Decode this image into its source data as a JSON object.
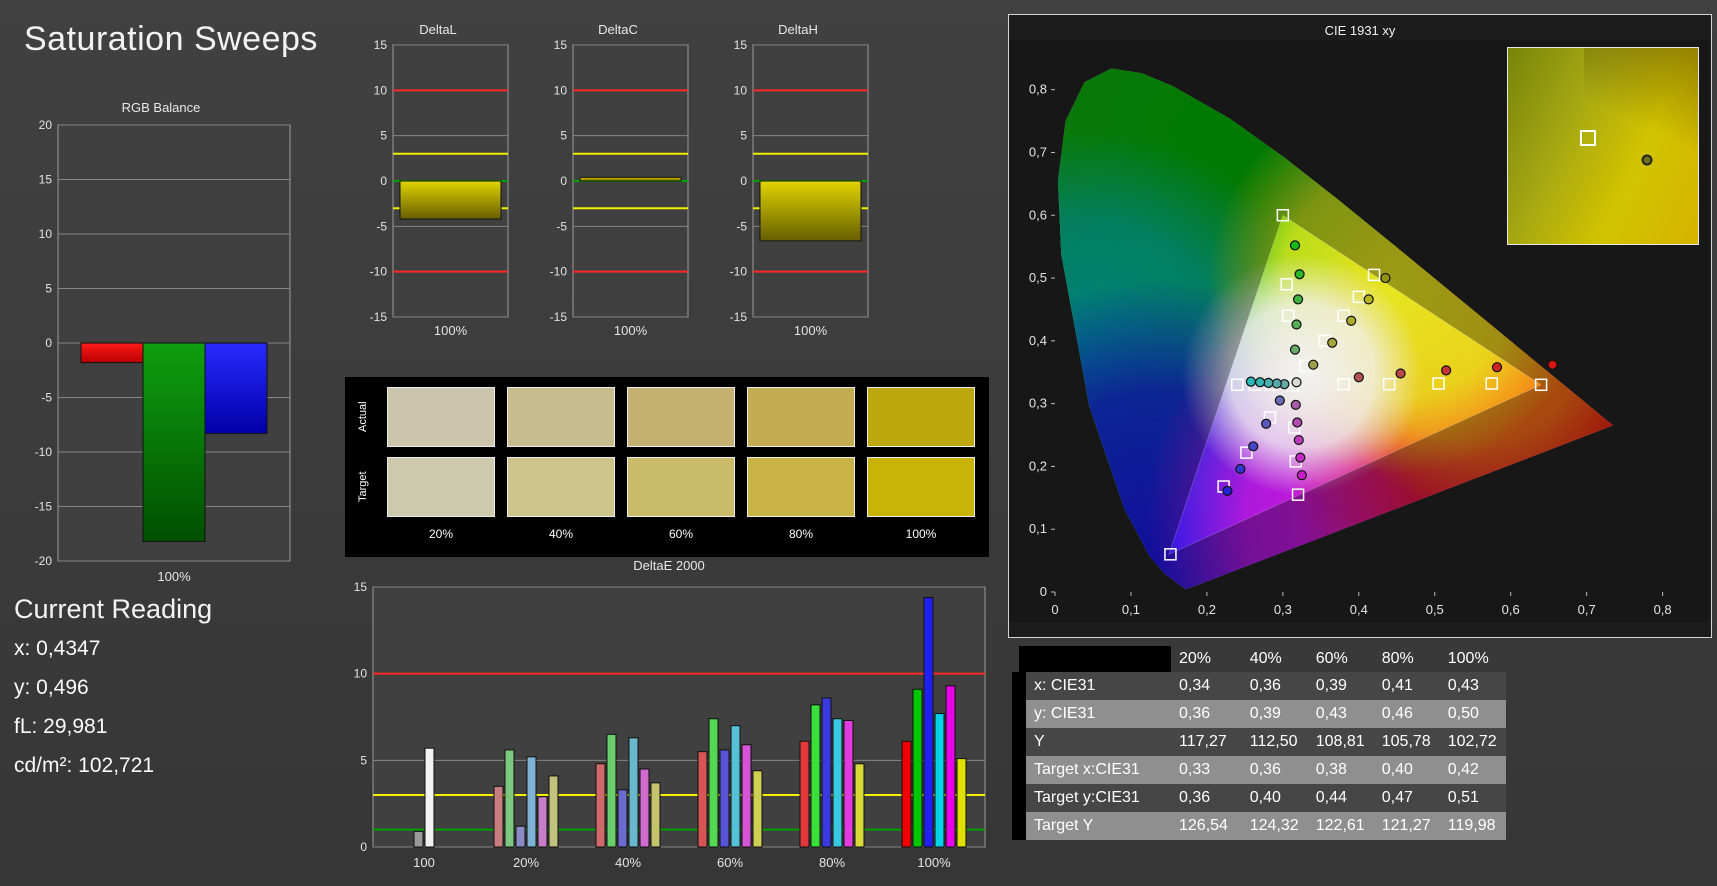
{
  "page": {
    "title": "Saturation Sweeps"
  },
  "rgb_balance": {
    "title": "RGB Balance",
    "xlabel": "100%",
    "ylim": [
      -20,
      20
    ],
    "yticks": [
      20,
      15,
      10,
      5,
      0,
      -5,
      -10,
      -15,
      -20
    ],
    "bars": [
      {
        "name": "red",
        "value": -1.8,
        "colors": [
          "#ff1a1a",
          "#b80000"
        ]
      },
      {
        "name": "green",
        "value": -18.2,
        "colors": [
          "#0f9f0f",
          "#004f00"
        ]
      },
      {
        "name": "blue",
        "value": -8.3,
        "colors": [
          "#2a2aff",
          "#0000a8"
        ]
      }
    ]
  },
  "current_reading": {
    "title": "Current Reading",
    "lines": [
      "x: 0,4347",
      "y: 0,496",
      "fL: 29,981",
      "cd/m²: 102,721"
    ]
  },
  "delta_refs": [
    {
      "v": 10,
      "c": "#ff2828",
      "w": 2
    },
    {
      "v": -10,
      "c": "#ff2828",
      "w": 2
    },
    {
      "v": 3,
      "c": "#f0f000",
      "w": 2
    },
    {
      "v": -3,
      "c": "#f0f000",
      "w": 2
    },
    {
      "v": 0,
      "c": "#00a000",
      "w": 2
    }
  ],
  "delta_charts": [
    {
      "title": "DeltaL",
      "xlabel": "100%",
      "ylim": [
        -15,
        15
      ],
      "yticks": [
        15,
        10,
        5,
        0,
        -5,
        -10,
        -15
      ],
      "value": -4.2,
      "bar_gradient": [
        "#e0d400",
        "#665e00"
      ]
    },
    {
      "title": "DeltaC",
      "xlabel": "100%",
      "ylim": [
        -15,
        15
      ],
      "yticks": [
        15,
        10,
        5,
        0,
        -5,
        -10,
        -15
      ],
      "value": 0.4,
      "bar_gradient": [
        "#e0d400",
        "#665e00"
      ]
    },
    {
      "title": "DeltaH",
      "xlabel": "100%",
      "ylim": [
        -15,
        15
      ],
      "yticks": [
        15,
        10,
        5,
        0,
        -5,
        -10,
        -15
      ],
      "value": -6.6,
      "bar_gradient": [
        "#e0d400",
        "#665e00"
      ]
    }
  ],
  "swatches": {
    "row_labels": [
      "Actual",
      "Target"
    ],
    "col_labels": [
      "20%",
      "40%",
      "60%",
      "80%",
      "100%"
    ],
    "actual": [
      "#cbc5ab",
      "#c8bc8e",
      "#c5b273",
      "#c3ac52",
      "#bda70e"
    ],
    "target": [
      "#cdc9ad",
      "#ccc48b",
      "#cabb68",
      "#c9b345",
      "#c8b307"
    ]
  },
  "chart_data": {
    "type": "bar",
    "title": "DeltaE 2000",
    "ylim": [
      0,
      15
    ],
    "yticks": [
      15,
      10,
      5,
      0
    ],
    "ref_lines": [
      {
        "v": 10,
        "c": "#ff2828"
      },
      {
        "v": 3,
        "c": "#f0f000"
      },
      {
        "v": 1,
        "c": "#00a000"
      }
    ],
    "groups": [
      {
        "label": "100",
        "bars": [
          {
            "v": 0.9,
            "c": "#9a9a9a"
          },
          {
            "v": 5.7,
            "c": "#f2f2f2"
          }
        ]
      },
      {
        "label": "20%",
        "bars": [
          {
            "v": 3.5,
            "c": "#c77e7e"
          },
          {
            "v": 5.6,
            "c": "#7ec77e"
          },
          {
            "v": 1.2,
            "c": "#8a8ac7"
          },
          {
            "v": 5.2,
            "c": "#7fb3d6"
          },
          {
            "v": 2.9,
            "c": "#c77ec7"
          },
          {
            "v": 4.1,
            "c": "#c2c27e"
          }
        ]
      },
      {
        "label": "40%",
        "bars": [
          {
            "v": 4.8,
            "c": "#cf6a6a"
          },
          {
            "v": 6.5,
            "c": "#6acf6a"
          },
          {
            "v": 3.3,
            "c": "#6a6acf"
          },
          {
            "v": 6.3,
            "c": "#6ab8cf"
          },
          {
            "v": 4.5,
            "c": "#cf6acf"
          },
          {
            "v": 3.7,
            "c": "#c4c46a"
          }
        ]
      },
      {
        "label": "60%",
        "bars": [
          {
            "v": 5.5,
            "c": "#d65555"
          },
          {
            "v": 7.4,
            "c": "#55d655"
          },
          {
            "v": 5.6,
            "c": "#5555d6"
          },
          {
            "v": 7.0,
            "c": "#55c0d6"
          },
          {
            "v": 5.9,
            "c": "#d655d6"
          },
          {
            "v": 4.4,
            "c": "#cfcf55"
          }
        ]
      },
      {
        "label": "80%",
        "bars": [
          {
            "v": 6.1,
            "c": "#e03a3a"
          },
          {
            "v": 8.2,
            "c": "#3ae03a"
          },
          {
            "v": 8.6,
            "c": "#3a3ae0"
          },
          {
            "v": 7.4,
            "c": "#3ac8e0"
          },
          {
            "v": 7.3,
            "c": "#e03ae0"
          },
          {
            "v": 4.8,
            "c": "#d8d83a"
          }
        ]
      },
      {
        "label": "100%",
        "bars": [
          {
            "v": 6.1,
            "c": "#f00000"
          },
          {
            "v": 9.1,
            "c": "#00c800"
          },
          {
            "v": 14.4,
            "c": "#2020f0"
          },
          {
            "v": 7.7,
            "c": "#00d0e8"
          },
          {
            "v": 9.3,
            "c": "#e800e8"
          },
          {
            "v": 5.1,
            "c": "#e0e000"
          }
        ]
      }
    ]
  },
  "cie": {
    "title": "CIE 1931 xy",
    "xticks": [
      "0",
      "0,1",
      "0,2",
      "0,3",
      "0,4",
      "0,5",
      "0,6",
      "0,7",
      "0,8"
    ],
    "yticks": [
      "0",
      "0,1",
      "0,2",
      "0,3",
      "0,4",
      "0,5",
      "0,6",
      "0,7",
      "0,8"
    ],
    "targets": [
      [
        0.313,
        0.329
      ],
      [
        0.38,
        0.331
      ],
      [
        0.44,
        0.331
      ],
      [
        0.505,
        0.332
      ],
      [
        0.575,
        0.332
      ],
      [
        0.64,
        0.33
      ],
      [
        0.33,
        0.36
      ],
      [
        0.355,
        0.4
      ],
      [
        0.38,
        0.44
      ],
      [
        0.4,
        0.47
      ],
      [
        0.42,
        0.505
      ],
      [
        0.307,
        0.44
      ],
      [
        0.305,
        0.49
      ],
      [
        0.3,
        0.6
      ],
      [
        0.285,
        0.33
      ],
      [
        0.263,
        0.33
      ],
      [
        0.24,
        0.33
      ],
      [
        0.283,
        0.278
      ],
      [
        0.252,
        0.222
      ],
      [
        0.222,
        0.168
      ],
      [
        0.152,
        0.06
      ],
      [
        0.315,
        0.262
      ],
      [
        0.317,
        0.208
      ],
      [
        0.32,
        0.155
      ]
    ],
    "measurements": [
      {
        "x": 0.34,
        "y": 0.362,
        "c": "#9d9d4a"
      },
      {
        "x": 0.365,
        "y": 0.397,
        "c": "#a5a53a"
      },
      {
        "x": 0.39,
        "y": 0.432,
        "c": "#adad2b"
      },
      {
        "x": 0.413,
        "y": 0.466,
        "c": "#b5b51c"
      },
      {
        "x": 0.435,
        "y": 0.5,
        "c": "#93930e"
      },
      {
        "x": 0.4,
        "y": 0.342,
        "c": "#b25454"
      },
      {
        "x": 0.455,
        "y": 0.348,
        "c": "#bc4545"
      },
      {
        "x": 0.515,
        "y": 0.353,
        "c": "#c63535"
      },
      {
        "x": 0.582,
        "y": 0.358,
        "c": "#d02424"
      },
      {
        "x": 0.655,
        "y": 0.362,
        "c": "#da1313"
      },
      {
        "x": 0.316,
        "y": 0.386,
        "c": "#69aa69"
      },
      {
        "x": 0.318,
        "y": 0.426,
        "c": "#54ae54"
      },
      {
        "x": 0.32,
        "y": 0.466,
        "c": "#3fb23f"
      },
      {
        "x": 0.322,
        "y": 0.506,
        "c": "#2ab62a"
      },
      {
        "x": 0.316,
        "y": 0.552,
        "c": "#17ba17"
      },
      {
        "x": 0.302,
        "y": 0.331,
        "c": "#63a8a8"
      },
      {
        "x": 0.292,
        "y": 0.332,
        "c": "#55acac"
      },
      {
        "x": 0.281,
        "y": 0.333,
        "c": "#47b0b0"
      },
      {
        "x": 0.27,
        "y": 0.334,
        "c": "#39b4b4"
      },
      {
        "x": 0.258,
        "y": 0.335,
        "c": "#2bb8b8"
      },
      {
        "x": 0.296,
        "y": 0.305,
        "c": "#6a6ab3"
      },
      {
        "x": 0.278,
        "y": 0.268,
        "c": "#5858bd"
      },
      {
        "x": 0.261,
        "y": 0.232,
        "c": "#4646c7"
      },
      {
        "x": 0.244,
        "y": 0.196,
        "c": "#3434d1"
      },
      {
        "x": 0.227,
        "y": 0.161,
        "c": "#2222db"
      },
      {
        "x": 0.317,
        "y": 0.298,
        "c": "#a95ba9"
      },
      {
        "x": 0.319,
        "y": 0.27,
        "c": "#b14bb1"
      },
      {
        "x": 0.321,
        "y": 0.242,
        "c": "#b93bb9"
      },
      {
        "x": 0.323,
        "y": 0.214,
        "c": "#c12bc1"
      },
      {
        "x": 0.325,
        "y": 0.186,
        "c": "#c91bc9"
      },
      {
        "x": 0.318,
        "y": 0.334,
        "c": "#d8d8d8"
      }
    ],
    "inset": {
      "square_pos": [
        42,
        46
      ],
      "circle_pos": [
        73,
        57
      ],
      "circle_color": "#6e7020"
    }
  },
  "table": {
    "header": [
      "",
      "20%",
      "40%",
      "60%",
      "80%",
      "100%"
    ],
    "rows": [
      {
        "label": "x: CIE31",
        "values": [
          "0,34",
          "0,36",
          "0,39",
          "0,41",
          "0,43"
        ]
      },
      {
        "label": "y: CIE31",
        "values": [
          "0,36",
          "0,39",
          "0,43",
          "0,46",
          "0,50"
        ]
      },
      {
        "label": "Y",
        "values": [
          "117,27",
          "112,50",
          "108,81",
          "105,78",
          "102,72"
        ]
      },
      {
        "label": "Target x:CIE31",
        "values": [
          "0,33",
          "0,36",
          "0,38",
          "0,40",
          "0,42"
        ]
      },
      {
        "label": "Target y:CIE31",
        "values": [
          "0,36",
          "0,40",
          "0,44",
          "0,47",
          "0,51"
        ]
      },
      {
        "label": "Target Y",
        "values": [
          "126,54",
          "124,32",
          "122,61",
          "121,27",
          "119,98"
        ]
      }
    ]
  }
}
